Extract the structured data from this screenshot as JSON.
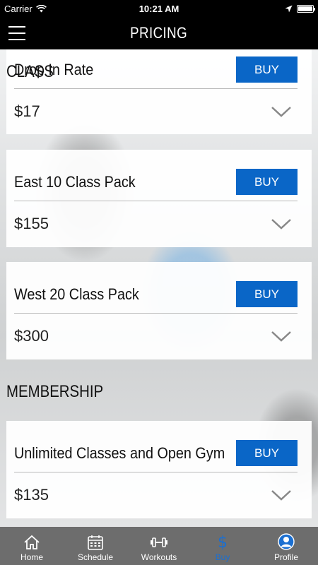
{
  "status_bar": {
    "carrier": "Carrier",
    "time": "10:21 AM",
    "battery_level": 1.0
  },
  "header": {
    "title": "PRICING"
  },
  "sections": {
    "class_label": "CLASS",
    "membership_label": "MEMBERSHIP"
  },
  "cards": [
    {
      "title": "Drop In Rate",
      "price": "$17",
      "buy_label": "BUY"
    },
    {
      "title": "East 10 Class Pack",
      "price": "$155",
      "buy_label": "BUY"
    },
    {
      "title": "West 20 Class Pack",
      "price": "$300",
      "buy_label": "BUY"
    },
    {
      "title": "Unlimited Classes and Open Gym",
      "price": "$135",
      "buy_label": "BUY"
    }
  ],
  "tabs": [
    {
      "label": "Home",
      "icon": "home-icon"
    },
    {
      "label": "Schedule",
      "icon": "calendar-icon"
    },
    {
      "label": "Workouts",
      "icon": "dumbbell-icon"
    },
    {
      "label": "Buy",
      "icon": "dollar-icon",
      "active": true
    },
    {
      "label": "Profile",
      "icon": "profile-icon"
    }
  ],
  "colors": {
    "accent": "#0a66c7",
    "active_tab": "#1b6fd1",
    "tab_bar": "#6d6d6d",
    "nav_bar": "#000000"
  }
}
